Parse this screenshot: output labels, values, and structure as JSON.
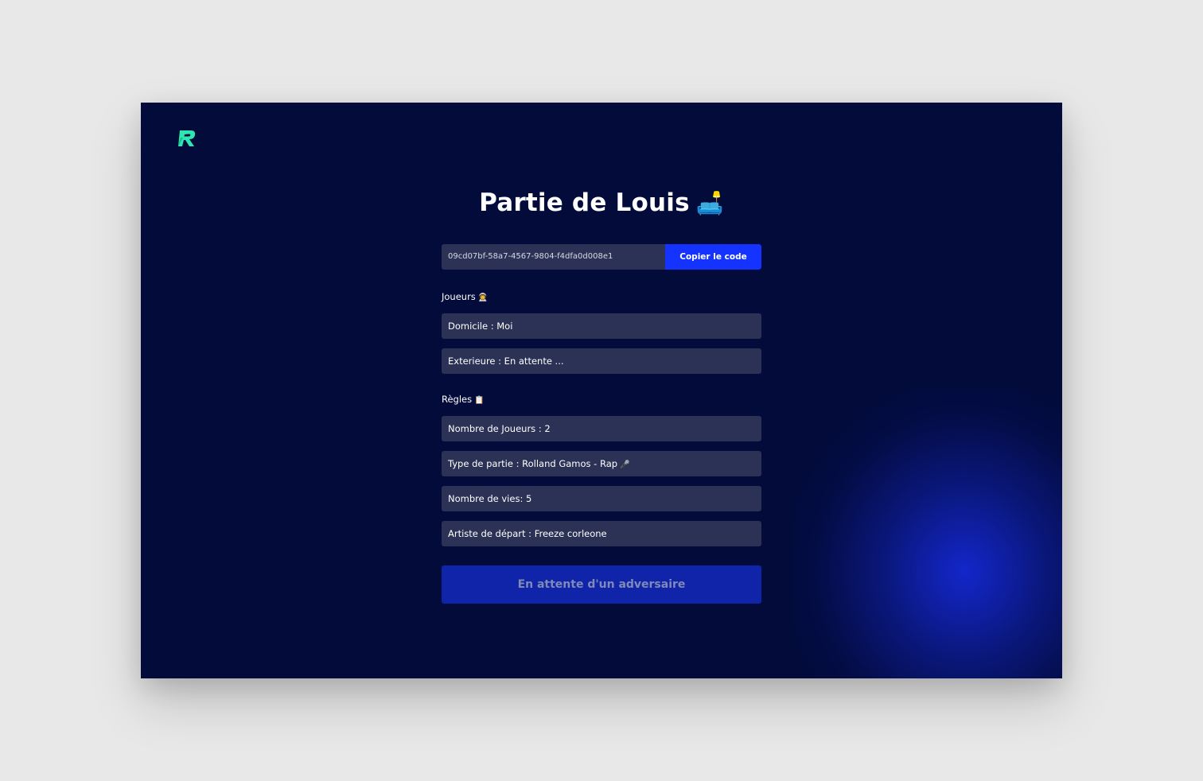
{
  "game": {
    "title": "Partie de Louis",
    "title_emoji": "🛋️",
    "code": "09cd07bf-58a7-4567-9804-f4dfa0d008e1",
    "copy_label": "Copier le code"
  },
  "players": {
    "heading": "Joueurs",
    "heading_emoji": "👨‍🚀",
    "home": "Domicile : Moi",
    "away": "Exterieure : En attente ..."
  },
  "rules": {
    "heading": "Règles",
    "heading_emoji": "📋",
    "player_count": "Nombre de Joueurs : 2",
    "game_type": "Type de partie : Rolland Gamos - Rap",
    "game_type_emoji": "🎤",
    "lives": "Nombre de vies: 5",
    "start_artist": "Artiste de départ : Freeze corleone"
  },
  "status_button": "En attente d'un adversaire",
  "colors": {
    "background": "#020b3a",
    "accent": "#1433ff",
    "field": "#2b3255",
    "logo": "#2ee6b0"
  },
  "icons": {
    "logo": "r-logo-icon"
  }
}
